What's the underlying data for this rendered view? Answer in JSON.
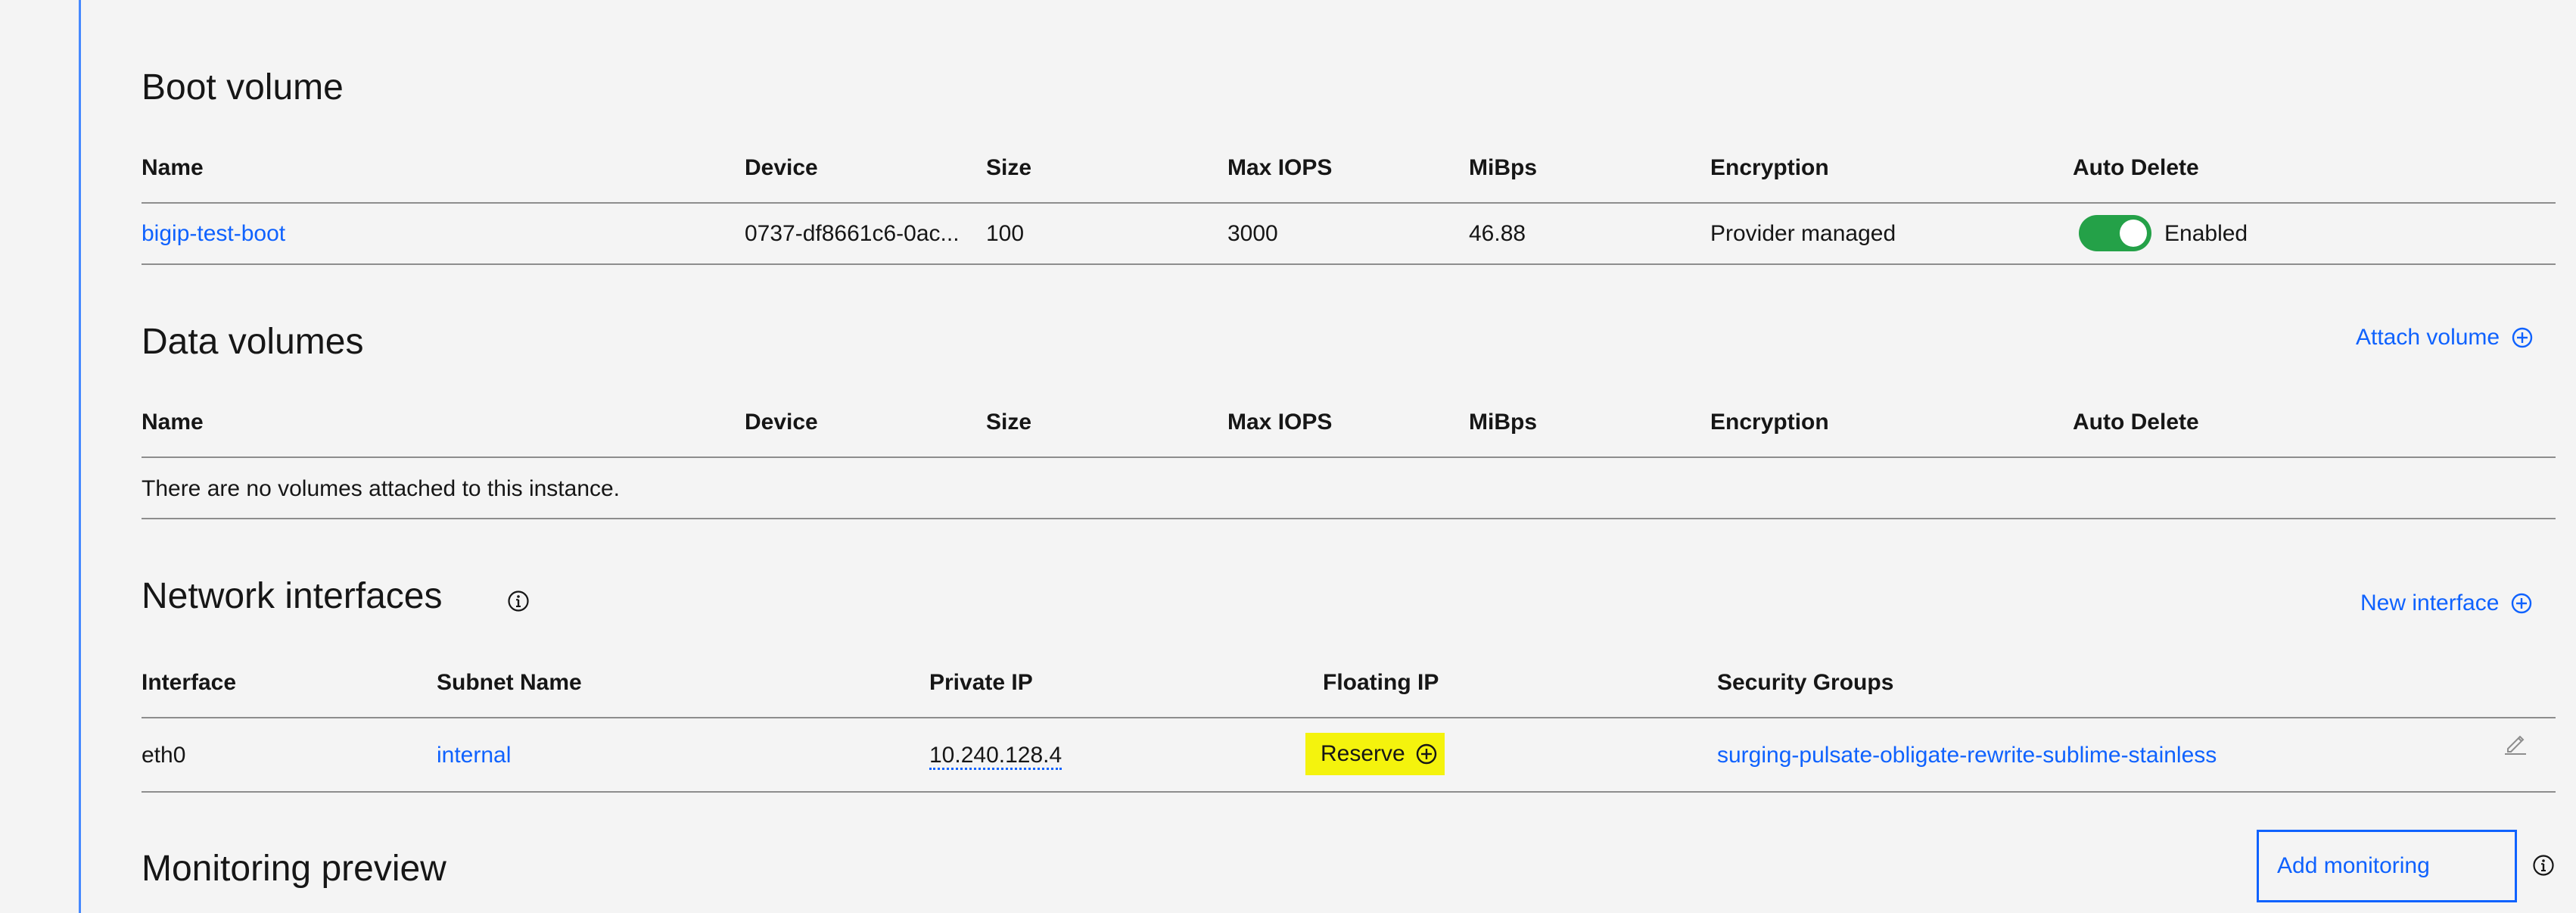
{
  "boot_volume": {
    "title": "Boot volume",
    "headers": [
      "Name",
      "Device",
      "Size",
      "Max IOPS",
      "MiBps",
      "Encryption",
      "Auto Delete"
    ],
    "row": {
      "name": "bigip-test-boot",
      "device": "0737-df8661c6-0ac...",
      "size": "100",
      "max_iops": "3000",
      "mibps": "46.88",
      "encryption": "Provider managed",
      "auto_delete_state": "Enabled",
      "auto_delete_on": true
    }
  },
  "data_volumes": {
    "title": "Data volumes",
    "action_label": "Attach volume",
    "headers": [
      "Name",
      "Device",
      "Size",
      "Max IOPS",
      "MiBps",
      "Encryption",
      "Auto Delete"
    ],
    "empty_message": "There are no volumes attached to this instance."
  },
  "network_interfaces": {
    "title": "Network interfaces",
    "action_label": "New interface",
    "headers": [
      "Interface",
      "Subnet Name",
      "Private IP",
      "Floating IP",
      "Security Groups"
    ],
    "row": {
      "interface": "eth0",
      "subnet": "internal",
      "private_ip": "10.240.128.4",
      "floating_ip_action": "Reserve",
      "security_groups": "surging-pulsate-obligate-rewrite-sublime-stainless"
    }
  },
  "monitoring": {
    "title": "Monitoring preview",
    "button_label": "Add monitoring"
  },
  "icons": {
    "add": "plus-circle-icon",
    "info": "info-circle-icon",
    "edit": "pencil-icon"
  },
  "colors": {
    "background": "#f4f4f4",
    "link": "#0f62fe",
    "toggle_on": "#24a148",
    "highlight": "#f4f30d",
    "left_rule": "#4589ff"
  }
}
